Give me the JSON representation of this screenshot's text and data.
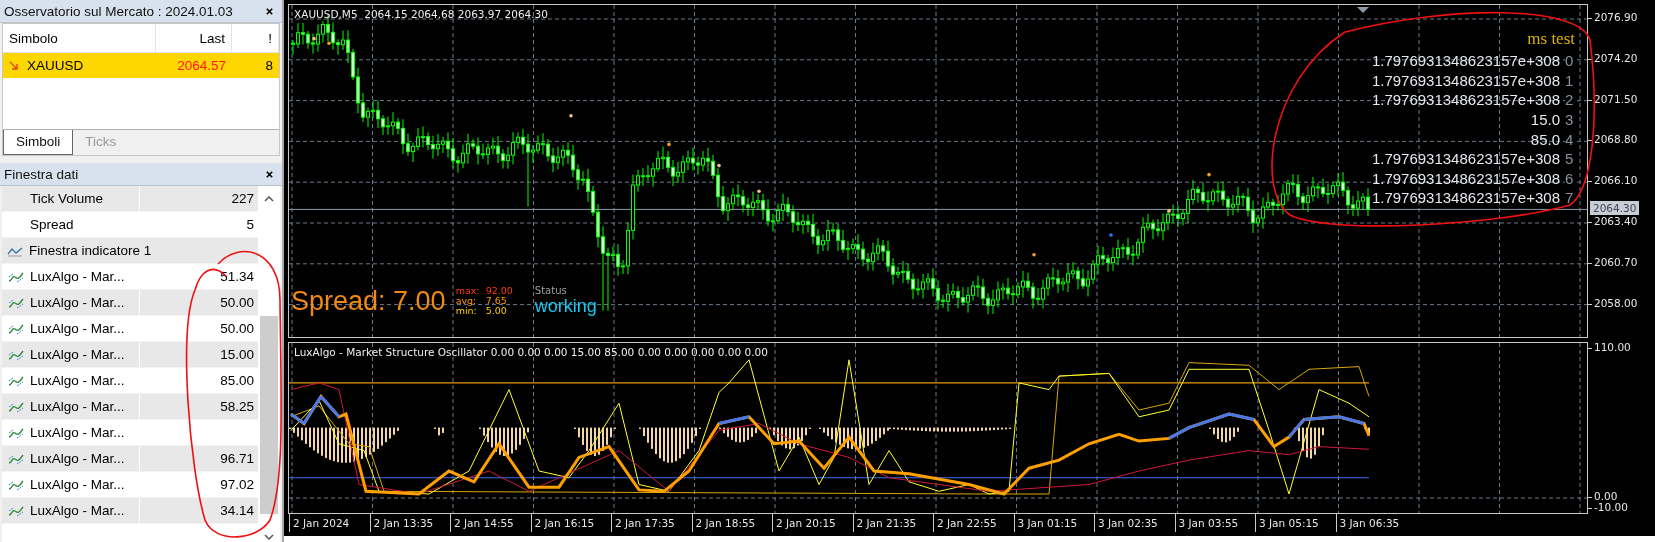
{
  "market_watch": {
    "title": "Osservatorio sul Mercato : 2024.01.03",
    "columns": [
      "Simbolo",
      "Last",
      "!"
    ],
    "rows": [
      {
        "symbol": "XAUUSD",
        "last": "2064.57",
        "count": "8",
        "selected": true
      }
    ],
    "tabs": [
      {
        "label": "Simboli",
        "selected": true
      },
      {
        "label": "Ticks",
        "selected": false
      }
    ]
  },
  "data_window": {
    "title": "Finestra dati",
    "rows": [
      {
        "kind": "field",
        "label": "Tick Volume",
        "value": "227"
      },
      {
        "kind": "field",
        "label": "Spread",
        "value": "5"
      },
      {
        "kind": "section",
        "label": "Finestra indicatore 1"
      },
      {
        "kind": "indicator",
        "label": "LuxAlgo - Mar...",
        "value": "51.34"
      },
      {
        "kind": "indicator",
        "label": "LuxAlgo - Mar...",
        "value": "50.00"
      },
      {
        "kind": "indicator",
        "label": "LuxAlgo - Mar...",
        "value": "50.00"
      },
      {
        "kind": "indicator",
        "label": "LuxAlgo - Mar...",
        "value": "15.00"
      },
      {
        "kind": "indicator",
        "label": "LuxAlgo - Mar...",
        "value": "85.00"
      },
      {
        "kind": "indicator",
        "label": "LuxAlgo - Mar...",
        "value": "58.25"
      },
      {
        "kind": "indicator",
        "label": "LuxAlgo - Mar..."
      },
      {
        "kind": "indicator",
        "label": "LuxAlgo - Mar...",
        "value": "96.71"
      },
      {
        "kind": "indicator",
        "label": "LuxAlgo - Mar...",
        "value": "97.02"
      },
      {
        "kind": "indicator",
        "label": "LuxAlgo - Mar...",
        "value": "34.14"
      }
    ]
  },
  "chart": {
    "title": "XAUUSD,M5  2064.15 2064.68 2063.97 2064.30",
    "price_axis": [
      "2076.90",
      "2074.20",
      "2071.50",
      "2068.80",
      "2066.10",
      "2063.40",
      "2060.70",
      "2058.00"
    ],
    "current_price": "2064.30",
    "overlay": {
      "title": "ms test",
      "rows": [
        {
          "value": "1.7976931348623157e+308",
          "index": "0"
        },
        {
          "value": "1.7976931348623157e+308",
          "index": "1"
        },
        {
          "value": "1.7976931348623157e+308",
          "index": "2"
        },
        {
          "value": "15.0",
          "index": "3"
        },
        {
          "value": "85.0",
          "index": "4"
        },
        {
          "value": "1.7976931348623157e+308",
          "index": "5"
        },
        {
          "value": "1.7976931348623157e+308",
          "index": "6"
        },
        {
          "value": "1.7976931348623157e+308",
          "index": "7"
        }
      ]
    },
    "spread": {
      "label": "Spread: 7.00",
      "stats": [
        {
          "kind": "max",
          "label": "max:",
          "value": "92.00"
        },
        {
          "kind": "avg",
          "label": "avg:",
          "value": "7.65"
        },
        {
          "kind": "min",
          "label": "min:",
          "value": "5.00"
        }
      ],
      "status_label": "Status",
      "status": "working"
    }
  },
  "oscillator": {
    "title": "LuxAlgo - Market Structure Oscillator 0.00 0.00 0.00 15.00 85.00 0.00 0.00 0.00 0.00 0.00",
    "axis": [
      "110.00",
      "0.00",
      "-10.00"
    ]
  },
  "time_axis": [
    "2 Jan 2024",
    "2 Jan 13:35",
    "2 Jan 14:55",
    "2 Jan 16:15",
    "2 Jan 17:35",
    "2 Jan 18:55",
    "2 Jan 20:15",
    "2 Jan 21:35",
    "2 Jan 22:55",
    "3 Jan 01:15",
    "3 Jan 02:35",
    "3 Jan 03:55",
    "3 Jan 05:15",
    "3 Jan 06:35"
  ]
}
